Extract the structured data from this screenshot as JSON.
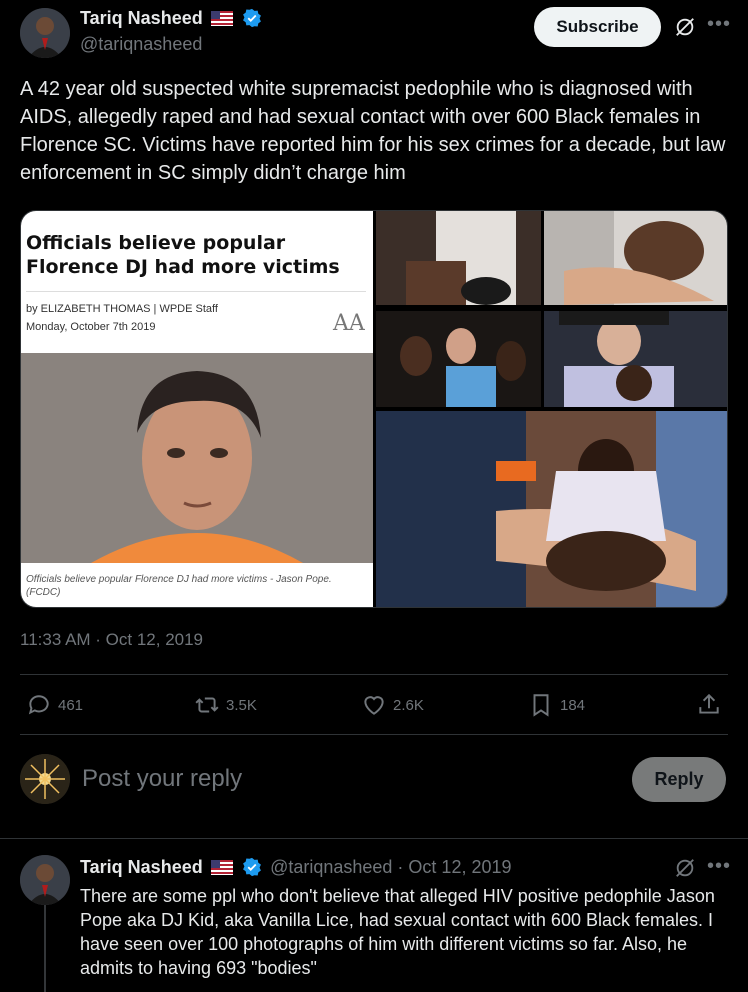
{
  "tweet": {
    "author_name": "Tariq Nasheed",
    "handle": "@tariqnasheed",
    "subscribe_label": "Subscribe",
    "text": "A 42 year old suspected white supremacist pedophile who is diagnosed with AIDS, allegedly raped and had sexual contact with over 600 Black females in Florence SC. Victims have reported him for his sex crimes for a decade, but law enforcement in SC simply didn’t charge him",
    "timestamp": "11:33 AM · Oct 12, 2019"
  },
  "article": {
    "title": "Officials believe popular Florence DJ had more victims",
    "byline": "by ELIZABETH THOMAS | WPDE Staff",
    "date": "Monday, October 7th 2019",
    "font_size_label": "AA",
    "caption": "Officials believe popular Florence DJ had more victims - Jason Pope. (FCDC)"
  },
  "actions": {
    "replies": "461",
    "reposts": "3.5K",
    "likes": "2.6K",
    "bookmarks": "184"
  },
  "reply_box": {
    "placeholder": "Post your reply",
    "button_label": "Reply"
  },
  "reply_tweet": {
    "author_name": "Tariq Nasheed",
    "meta": "@tariqnasheed · Oct 12, 2019",
    "text": "There are some ppl who don't believe that alleged HIV positive pedophile Jason Pope aka DJ Kid, aka Vanilla Lice, had sexual contact with 600 Black females. I have seen over 100 photographs of him with different victims so far. Also, he admits to having 693 \"bodies\""
  },
  "colors": {
    "background": "#000000",
    "text": "#e7e9ea",
    "muted": "#71767b",
    "verified": "#1d9bf0",
    "border": "#2f3336"
  },
  "icons": [
    "verified-badge-icon",
    "us-flag-icon",
    "grok-icon",
    "more-icon",
    "reply-icon",
    "repost-icon",
    "like-icon",
    "bookmark-icon",
    "share-icon"
  ]
}
